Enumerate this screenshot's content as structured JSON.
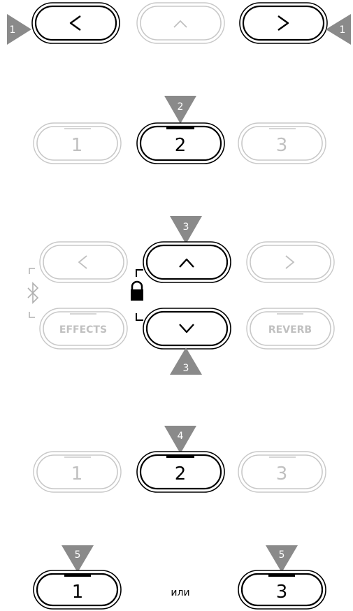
{
  "step1": {
    "left_button": "<",
    "up_button": "^",
    "right_button": ">",
    "marker_left": "1",
    "marker_right": "1"
  },
  "step2": {
    "button_1": "1",
    "button_2": "2",
    "button_3": "3",
    "marker": "2"
  },
  "step3": {
    "left_button": "<",
    "right_button": ">",
    "effects_button": "EFFECTS",
    "reverb_button": "REVERB",
    "up_button": "^",
    "down_button": "v",
    "marker_top": "3",
    "marker_bottom": "3"
  },
  "step4": {
    "button_1": "1",
    "button_2": "2",
    "button_3": "3",
    "marker": "4"
  },
  "step5": {
    "button_1": "1",
    "button_3": "3",
    "or_text": "или",
    "marker_left": "5",
    "marker_right": "5"
  }
}
